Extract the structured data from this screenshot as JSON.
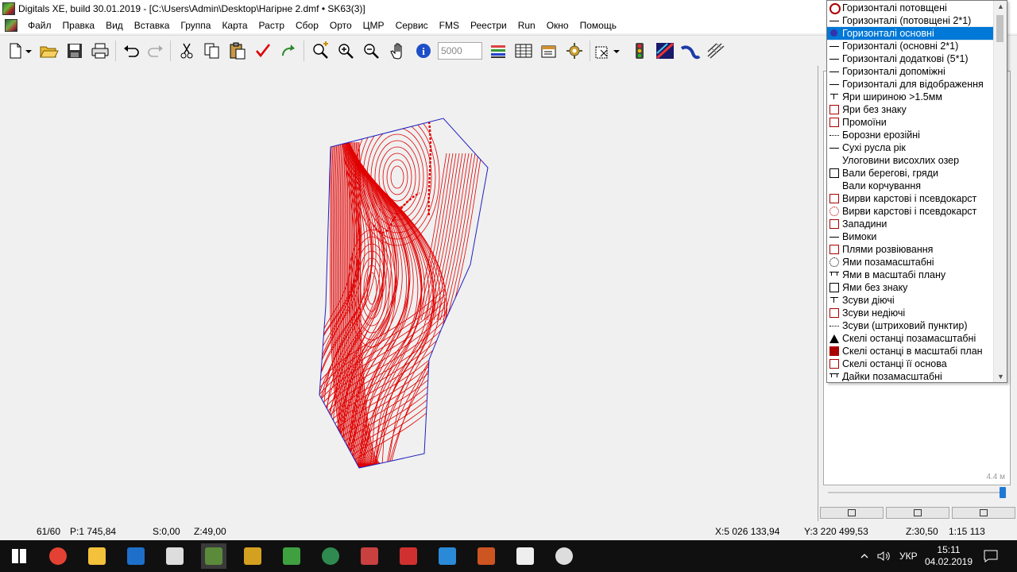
{
  "window": {
    "title": "Digitals XE, build 30.01.2019 - [C:\\Users\\Admin\\Desktop\\Нагірне 2.dmf • SK63(3)]"
  },
  "menu": [
    "Файл",
    "Правка",
    "Вид",
    "Вставка",
    "Группа",
    "Карта",
    "Растр",
    "Сбор",
    "Орто",
    "ЦМР",
    "Сервис",
    "FMS",
    "Реестри",
    "Run",
    "Окно",
    "Помощь"
  ],
  "toolbar": {
    "scale_value": "5000",
    "icons": [
      "new-file-icon",
      "dropdown-arrow-icon",
      "open-folder-icon",
      "save-icon",
      "print-icon",
      "undo-icon",
      "redo-icon",
      "cut-icon",
      "copy-icon",
      "paste-icon",
      "check-icon",
      "refresh-icon",
      "add-layer-icon",
      "zoom-in-icon",
      "zoom-out-icon",
      "hand-pan-icon",
      "info-icon",
      "layers-icon",
      "table-icon",
      "properties-icon",
      "gear-tools-icon",
      "select-cursor-icon",
      "traffic-light-icon",
      "line-tool-icon",
      "curve-tool-icon",
      "digitize-icon"
    ]
  },
  "layers": [
    {
      "label": "Горизонталі потовщені",
      "sym": "ring"
    },
    {
      "label": "Горизонталі (потовщені 2*1)",
      "sym": "line"
    },
    {
      "label": "Горизонталі основні",
      "sym": "dot",
      "selected": true
    },
    {
      "label": "Горизонталі (основні 2*1)",
      "sym": "line"
    },
    {
      "label": "Горизонталі додаткові (5*1)",
      "sym": "line"
    },
    {
      "label": "Горизонталі допоміжні",
      "sym": "line"
    },
    {
      "label": "Горизонталі для відображення",
      "sym": "line"
    },
    {
      "label": "Яри шириною >1.5мм",
      "sym": "tee"
    },
    {
      "label": "Яри без знаку",
      "sym": "box"
    },
    {
      "label": "Промоїни",
      "sym": "box"
    },
    {
      "label": "Борозни ерозійні",
      "sym": "dots"
    },
    {
      "label": "Сухі русла рік",
      "sym": "line"
    },
    {
      "label": "Улоговини висохлих озер",
      "sym": "none"
    },
    {
      "label": "Вали берегові, гряди",
      "sym": "blackbox"
    },
    {
      "label": "Вали корчування",
      "sym": "none"
    },
    {
      "label": "Вирви карстові і псевдокарст",
      "sym": "box"
    },
    {
      "label": "Вирви карстові і псевдокарст",
      "sym": "circ"
    },
    {
      "label": "Западини",
      "sym": "box"
    },
    {
      "label": "Вимоки",
      "sym": "line"
    },
    {
      "label": "Плями розвіювання",
      "sym": "box"
    },
    {
      "label": "Ями позамасштабні",
      "sym": "circblack"
    },
    {
      "label": "Ями в масштабі плану",
      "sym": "tt"
    },
    {
      "label": "Ями  без знаку",
      "sym": "blackbox"
    },
    {
      "label": "Зсуви діючі",
      "sym": "tee"
    },
    {
      "label": "Зсуви недіючі",
      "sym": "box"
    },
    {
      "label": "Зсуви (штриховий пунктир)",
      "sym": "dots"
    },
    {
      "label": "Скелі останці позамасштабні",
      "sym": "tri"
    },
    {
      "label": "Скелі останці в масштабі план",
      "sym": "filled"
    },
    {
      "label": "Скелі останці її основа",
      "sym": "box"
    },
    {
      "label": "Дайки позамасштабні",
      "sym": "tt"
    }
  ],
  "right_panel": {
    "distance": "4.4 м"
  },
  "status": {
    "count": "61/60",
    "perimeter": "P:1 745,84",
    "area": "S:0,00",
    "z_left": "Z:49,00",
    "x": "X:5 026 133,94",
    "y": "Y:3 220 499,53",
    "z_right": "Z:30,50",
    "scale": "1:15 113"
  },
  "taskbar": {
    "lang": "УКР",
    "time": "15:11",
    "date": "04.02.2019",
    "apps": [
      {
        "name": "start-button",
        "color": "#ffffff"
      },
      {
        "name": "chrome-app",
        "color": "#e34133"
      },
      {
        "name": "explorer-app",
        "color": "#f3c13a"
      },
      {
        "name": "outlook-app",
        "color": "#1e6fc9"
      },
      {
        "name": "tool-app",
        "color": "#dddddd"
      },
      {
        "name": "digitals-app",
        "color": "#5a8a3a"
      },
      {
        "name": "map-app",
        "color": "#d4a020"
      },
      {
        "name": "recycle-app",
        "color": "#3fa040"
      },
      {
        "name": "globe-app",
        "color": "#2f8a4f"
      },
      {
        "name": "map2-app",
        "color": "#c84040"
      },
      {
        "name": "archive-app",
        "color": "#d03030"
      },
      {
        "name": "vscode-app",
        "color": "#2a8ad8"
      },
      {
        "name": "disk-app",
        "color": "#cc5522"
      },
      {
        "name": "settings-app",
        "color": "#eeeeee"
      },
      {
        "name": "obs-app",
        "color": "#dddddd"
      }
    ]
  },
  "colors": {
    "contour": "#e00000",
    "boundary": "#2020c0",
    "selection": "#0078d7"
  }
}
